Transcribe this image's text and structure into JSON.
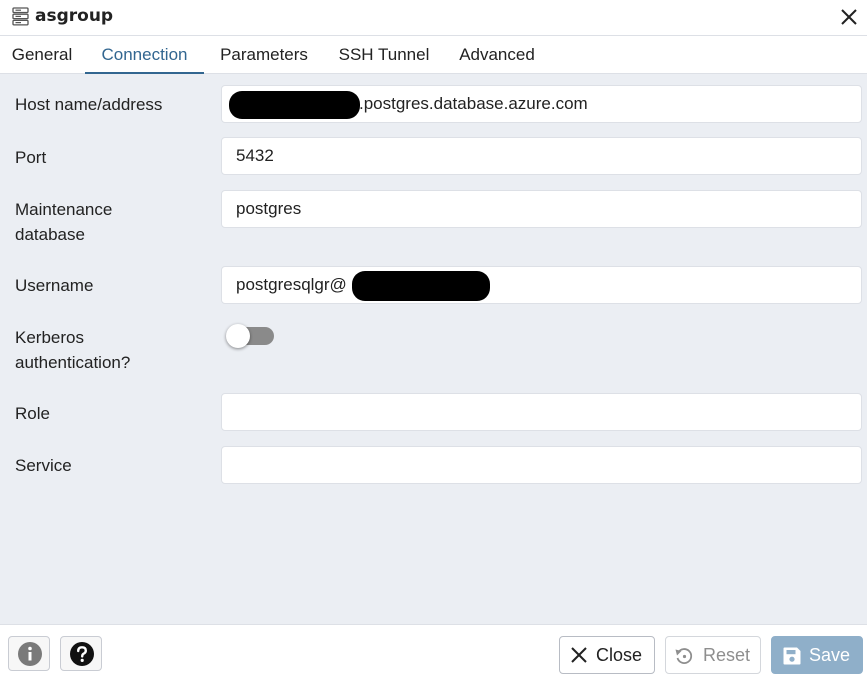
{
  "window": {
    "title": "asgroup",
    "icon": "server-group-icon",
    "close_icon": "close-icon"
  },
  "tabs": [
    {
      "label": "General",
      "active": false
    },
    {
      "label": "Connection",
      "active": true
    },
    {
      "label": "Parameters",
      "active": false
    },
    {
      "label": "SSH Tunnel",
      "active": false
    },
    {
      "label": "Advanced",
      "active": false
    }
  ],
  "form": {
    "host": {
      "label": "Host name/address",
      "value": ".postgres.database.azure.com",
      "redacted_prefix": true
    },
    "port": {
      "label": "Port",
      "value": "5432"
    },
    "maintenance_db": {
      "label_line1": "Maintenance",
      "label_line2": "database",
      "value": "postgres"
    },
    "username": {
      "label": "Username",
      "value": "postgresqlgr@",
      "redacted_suffix": true
    },
    "kerberos": {
      "label_line1": "Kerberos",
      "label_line2": "authentication?",
      "enabled": false
    },
    "role": {
      "label": "Role",
      "value": ""
    },
    "service": {
      "label": "Service",
      "value": ""
    }
  },
  "footer": {
    "info_icon": "info-icon",
    "help_icon": "help-icon",
    "close_label": "Close",
    "reset_label": "Reset",
    "save_label": "Save"
  },
  "colors": {
    "accent": "#326690",
    "save_button": "#8fafc9",
    "background": "#ebeef3",
    "toggle_off": "#8a8a8a"
  }
}
